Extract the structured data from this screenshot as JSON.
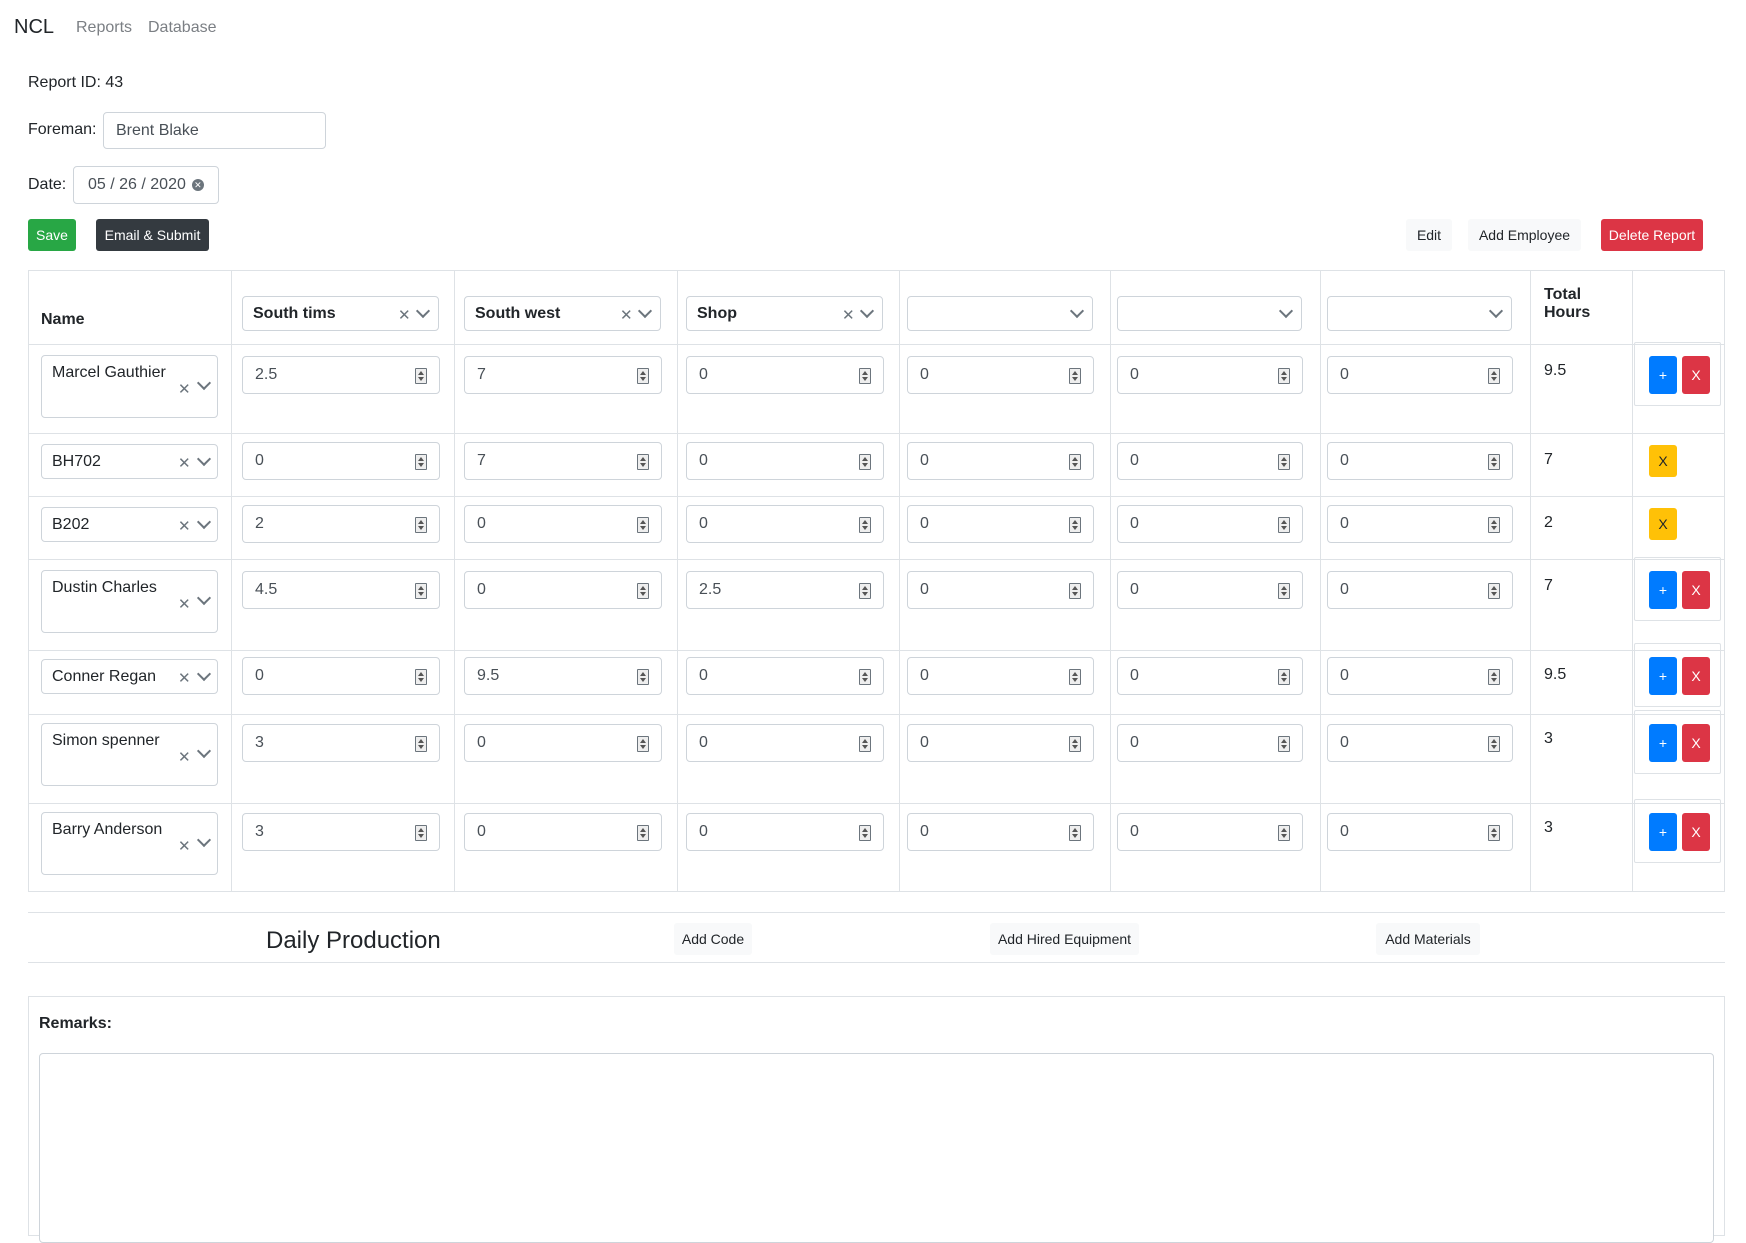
{
  "nav": {
    "brand": "NCL",
    "links": [
      "Reports",
      "Database"
    ]
  },
  "report": {
    "id_text": "Report ID: 43",
    "foreman_label": "Foreman:",
    "foreman_value": "Brent Blake",
    "date_label": "Date:",
    "date_value": "05 / 26 / 2020"
  },
  "toolbar": {
    "save": "Save",
    "email_submit": "Email & Submit",
    "edit": "Edit",
    "add_employee": "Add Employee",
    "delete_report": "Delete Report"
  },
  "table": {
    "name_header": "Name",
    "total_header_line1": "Total",
    "total_header_line2": "Hours",
    "job_columns": [
      "South tims",
      "South west",
      "Shop",
      "",
      "",
      ""
    ],
    "rows": [
      {
        "name": "Marcel Gauthier",
        "hours": [
          "2.5",
          "7",
          "0",
          "0",
          "0",
          "0"
        ],
        "total": "9.5",
        "actions": [
          "+",
          "X"
        ]
      },
      {
        "name": "BH702",
        "hours": [
          "0",
          "7",
          "0",
          "0",
          "0",
          "0"
        ],
        "total": "7",
        "actions": [
          "X"
        ]
      },
      {
        "name": "B202",
        "hours": [
          "2",
          "0",
          "0",
          "0",
          "0",
          "0"
        ],
        "total": "2",
        "actions": [
          "X"
        ]
      },
      {
        "name": "Dustin Charles",
        "hours": [
          "4.5",
          "0",
          "2.5",
          "0",
          "0",
          "0"
        ],
        "total": "7",
        "actions": [
          "+",
          "X"
        ]
      },
      {
        "name": "Conner Regan",
        "hours": [
          "0",
          "9.5",
          "0",
          "0",
          "0",
          "0"
        ],
        "total": "9.5",
        "actions": [
          "+",
          "X"
        ]
      },
      {
        "name": "Simon spenner",
        "hours": [
          "3",
          "0",
          "0",
          "0",
          "0",
          "0"
        ],
        "total": "3",
        "actions": [
          "+",
          "X"
        ]
      },
      {
        "name": "Barry Anderson",
        "hours": [
          "3",
          "0",
          "0",
          "0",
          "0",
          "0"
        ],
        "total": "3",
        "actions": [
          "+",
          "X"
        ]
      }
    ]
  },
  "production": {
    "title": "Daily Production",
    "add_code": "Add Code",
    "add_hired_equipment": "Add Hired Equipment",
    "add_materials": "Add Materials"
  },
  "remarks": {
    "label": "Remarks:",
    "value": ""
  },
  "colors": {
    "success": "#28a745",
    "dark": "#343a40",
    "danger": "#dc3545",
    "primary": "#007bff",
    "warning": "#ffc107",
    "light": "#f8f9fa"
  }
}
